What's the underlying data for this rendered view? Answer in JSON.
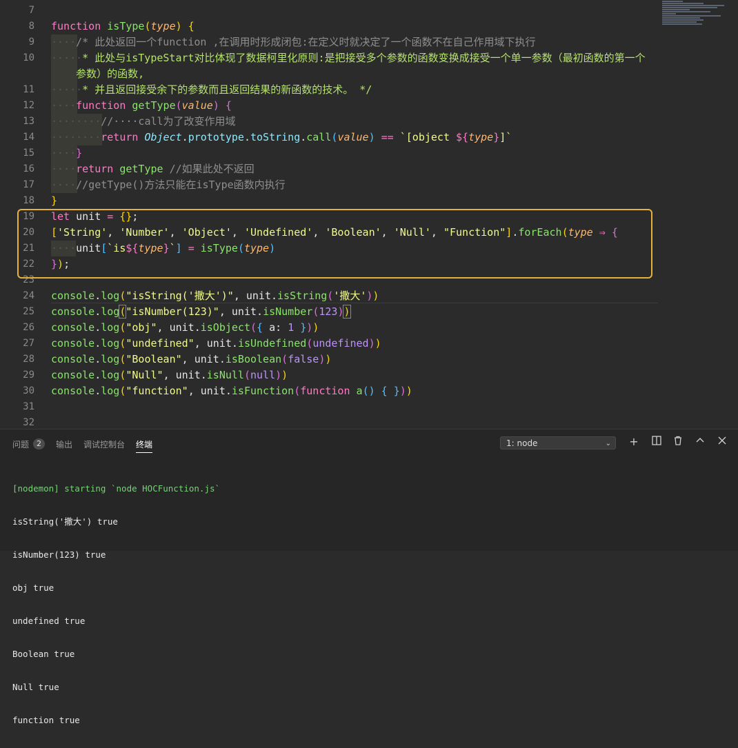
{
  "editor": {
    "line_numbers": [
      "7",
      "8",
      "9",
      "10",
      "",
      "11",
      "12",
      "13",
      "14",
      "15",
      "16",
      "17",
      "18",
      "19",
      "20",
      "21",
      "22",
      "23",
      "24",
      "25",
      "26",
      "27",
      "28",
      "29",
      "30",
      "31",
      "32"
    ]
  },
  "panel": {
    "tabs": [
      "问题",
      "输出",
      "调试控制台",
      "终端"
    ],
    "problems_count": "2",
    "terminal_select": "1: node",
    "terminal_lines": [
      "[nodemon] starting `node HOCFunction.js`",
      "isString('撒大') true",
      "isNumber(123) true",
      "obj true",
      "undefined true",
      "Boolean true",
      "Null true",
      "function true"
    ]
  },
  "colors": {
    "highlight_border": "#e8b13c",
    "editor_bg": "#2b2b2b"
  },
  "icons": [
    "plus-icon",
    "split-terminal-icon",
    "trash-icon",
    "chevron-up-icon",
    "close-icon",
    "chevron-down-icon"
  ]
}
